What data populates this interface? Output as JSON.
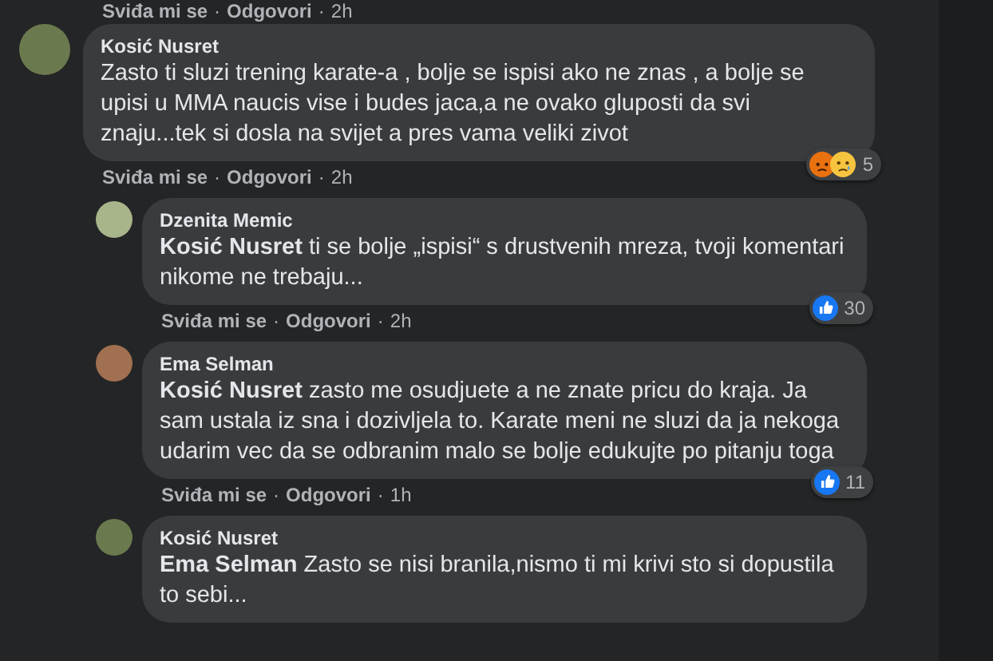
{
  "previous_meta": [
    {
      "kind": "link",
      "text": "Sviđa mi se"
    },
    {
      "kind": "sep",
      "text": "·"
    },
    {
      "kind": "link",
      "text": "Odgovori"
    },
    {
      "kind": "sep",
      "text": "·"
    },
    {
      "kind": "time",
      "text": "2h"
    }
  ],
  "comments": [
    {
      "kind": "top",
      "author": "Kosić Nusret",
      "text": "Zasto ti sluzi trening karate-a , bolje se ispisi ako ne znas , a bolje se upisi u MMA naucis vise i budes jaca,a ne ovako gluposti da svi znaju...tek si dosla na svijet a pres vama veliki zivot",
      "reactions": [
        {
          "kind": "angry"
        },
        {
          "kind": "sad"
        }
      ],
      "count": "5",
      "meta": [
        {
          "kind": "link",
          "text": "Sviđa mi se"
        },
        {
          "kind": "sep",
          "text": "·"
        },
        {
          "kind": "link",
          "text": "Odgovori"
        },
        {
          "kind": "sep",
          "text": "·"
        },
        {
          "kind": "time",
          "text": "2h"
        }
      ]
    },
    {
      "kind": "reply",
      "author": "Dzenita Memic",
      "mention": "Kosić Nusret",
      "text": "ti se bolje „ispisi“ s drustvenih mreza, tvoji komentari nikome ne trebaju...",
      "reactions": [
        {
          "kind": "like"
        }
      ],
      "count": "30",
      "meta": [
        {
          "kind": "link",
          "text": "Sviđa mi se"
        },
        {
          "kind": "sep",
          "text": "·"
        },
        {
          "kind": "link",
          "text": "Odgovori"
        },
        {
          "kind": "sep",
          "text": "·"
        },
        {
          "kind": "time",
          "text": "2h"
        }
      ]
    },
    {
      "kind": "reply",
      "author": "Ema Selman",
      "mention": "Kosić Nusret",
      "text": "zasto me osudjuete a ne znate pricu do kraja. Ja sam ustala iz sna i dozivljela to. Karate meni ne sluzi da ja nekoga udarim vec da se odbranim malo se bolje edukujte po pitanju toga",
      "reactions": [
        {
          "kind": "like"
        }
      ],
      "count": "11",
      "meta": [
        {
          "kind": "link",
          "text": "Sviđa mi se"
        },
        {
          "kind": "sep",
          "text": "·"
        },
        {
          "kind": "link",
          "text": "Odgovori"
        },
        {
          "kind": "sep",
          "text": "·"
        },
        {
          "kind": "time",
          "text": "1h"
        }
      ]
    },
    {
      "kind": "reply",
      "author": "Kosić Nusret",
      "mention": "Ema Selman",
      "text": "Zasto se nisi branila,nismo ti mi krivi sto si dopustila to sebi..."
    }
  ]
}
